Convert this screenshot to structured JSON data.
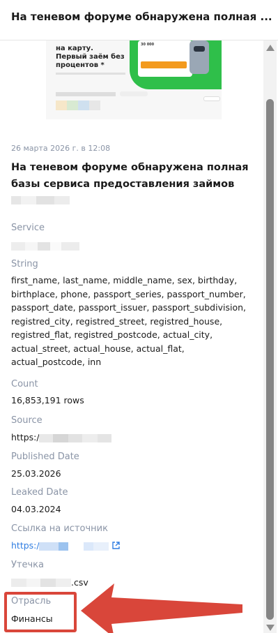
{
  "header": {
    "title": "На теневом форуме обнаружена полная ..."
  },
  "preview": {
    "headline": "на карту. Первый заём без процентов *",
    "card_amount": "30 000",
    "brand_colors": [
      "#2fbf4a",
      "#f39a1d",
      "#9aa7b5"
    ]
  },
  "article": {
    "date": "26 марта 2026 г. в 12:08",
    "title": "На теневом форуме обнаружена полная базы сервиса предоставления займов"
  },
  "fields": {
    "service": {
      "label": "Service"
    },
    "string": {
      "label": "String",
      "value": "first_name, last_name, middle_name, sex, birthday, birthplace, phone, passport_series, passport_number, passport_date, passport_issuer, passport_subdivision, registred_city, registred_street, registred_house, registred_flat, registred_postcode, actual_city, actual_street, actual_house, actual_flat, actual_postcode, inn"
    },
    "count": {
      "label": "Count",
      "value": "16,853,191 rows"
    },
    "source": {
      "label": "Source",
      "value": "https:/"
    },
    "published": {
      "label": "Published Date",
      "value": "25.03.2026"
    },
    "leaked": {
      "label": "Leaked Date",
      "value": "04.03.2024"
    },
    "source_link": {
      "label": "Ссылка на источник",
      "value": "https:/"
    },
    "leak": {
      "label": "Утечка",
      "value": ".csv"
    },
    "industry": {
      "label": "Отрасль",
      "value": "Финансы"
    }
  },
  "icons": {
    "external_link": "external-link-icon",
    "scroll_up": "scroll-up-arrow-icon",
    "scroll_down": "scroll-down-arrow-icon"
  },
  "colors": {
    "label": "#8a94a6",
    "link": "#2f7de1",
    "annotation": "#d9463a"
  }
}
